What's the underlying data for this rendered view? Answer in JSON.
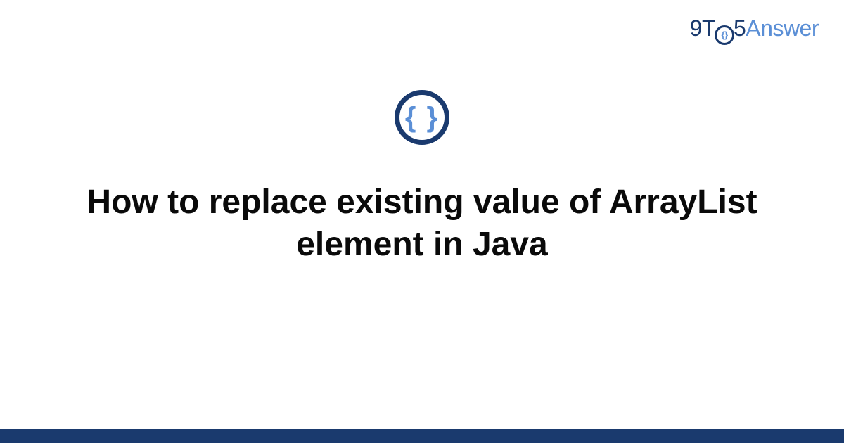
{
  "logo": {
    "part1": "9T",
    "part2": "5",
    "part3": "Answer"
  },
  "icon": {
    "braces": "{ }"
  },
  "title": "How to replace existing value of ArrayList element in Java"
}
